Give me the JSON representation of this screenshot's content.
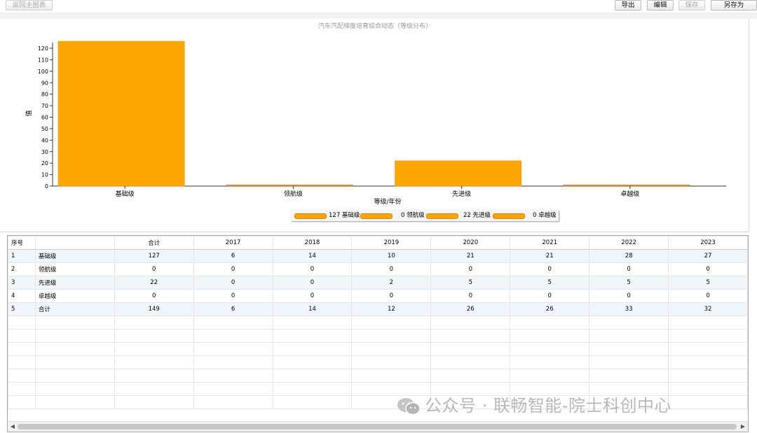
{
  "toolbar": {
    "back_label": "返回主图表",
    "export_label": "导出",
    "edit_label": "编辑",
    "save_label": "保存",
    "save_as_label": "另存为"
  },
  "chart_data": {
    "type": "bar",
    "title": "汽车汽配梯度培育综合动态（等级分布）",
    "xlabel": "等级/年份",
    "ylabel": "值",
    "categories": [
      "基础级",
      "领航级",
      "先进级",
      "卓越级"
    ],
    "values": [
      127,
      0,
      22,
      0
    ],
    "ylim": [
      0,
      120
    ],
    "yticks": [
      0,
      10,
      20,
      30,
      40,
      50,
      60,
      70,
      80,
      90,
      100,
      110,
      120
    ],
    "bar_color": "#ffa500",
    "legend_position": "bottom",
    "legend": [
      "127 基础级",
      "0 领航级",
      "22 先进级",
      "0 卓越级"
    ]
  },
  "table": {
    "headers": [
      "序号",
      "",
      "合计",
      "2017",
      "2018",
      "2019",
      "2020",
      "2021",
      "2022",
      "2023"
    ],
    "rows": [
      [
        "1",
        "基础级",
        "127",
        "6",
        "14",
        "10",
        "21",
        "21",
        "28",
        "27"
      ],
      [
        "2",
        "领航级",
        "0",
        "0",
        "0",
        "0",
        "0",
        "0",
        "0",
        "0"
      ],
      [
        "3",
        "先进级",
        "22",
        "0",
        "0",
        "2",
        "5",
        "5",
        "5",
        "5"
      ],
      [
        "4",
        "卓越级",
        "0",
        "0",
        "0",
        "0",
        "0",
        "0",
        "0",
        "0"
      ],
      [
        "5",
        "合计",
        "149",
        "6",
        "14",
        "12",
        "26",
        "26",
        "33",
        "32"
      ]
    ]
  },
  "watermark": {
    "text": "公众号 · 联畅智能-院士科创中心"
  }
}
